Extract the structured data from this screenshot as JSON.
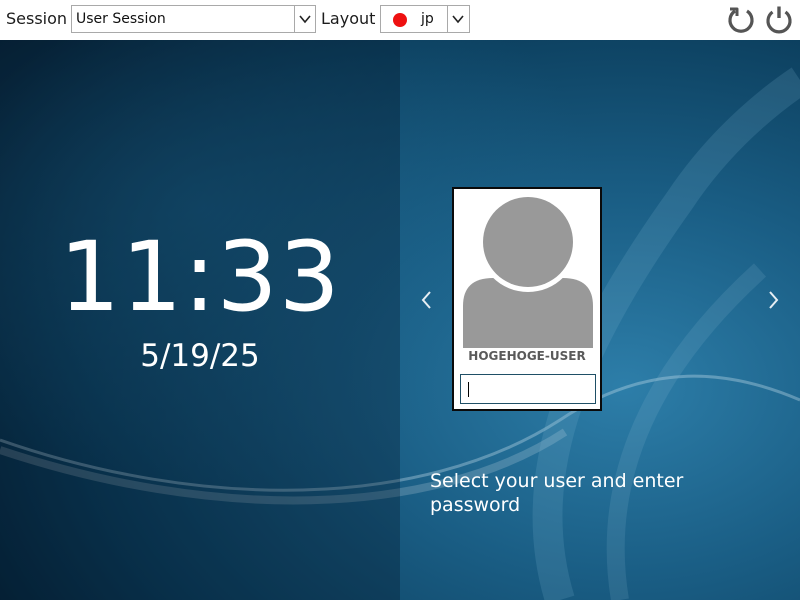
{
  "colors": {
    "topbar_bg": "#ffffff",
    "background_base": "#0c4566",
    "card_bg": "#ffffff",
    "avatar_gray": "#999999",
    "flag_red": "#ee1111"
  },
  "topbar": {
    "session_label": "Session",
    "session_value": "User Session",
    "layout_label": "Layout",
    "layout_value": "jp",
    "layout_flag_color": "#ee1111",
    "icons": [
      "chevron-down-icon",
      "restart-icon",
      "power-icon"
    ]
  },
  "clock": {
    "time": "11:33",
    "date": "5/19/25"
  },
  "user_card": {
    "username": "HOGEHOGE-USER",
    "password_value": "",
    "icons": [
      "user-avatar-icon",
      "chevron-left-icon",
      "chevron-right-icon"
    ]
  },
  "hint": "Select your user and enter password"
}
